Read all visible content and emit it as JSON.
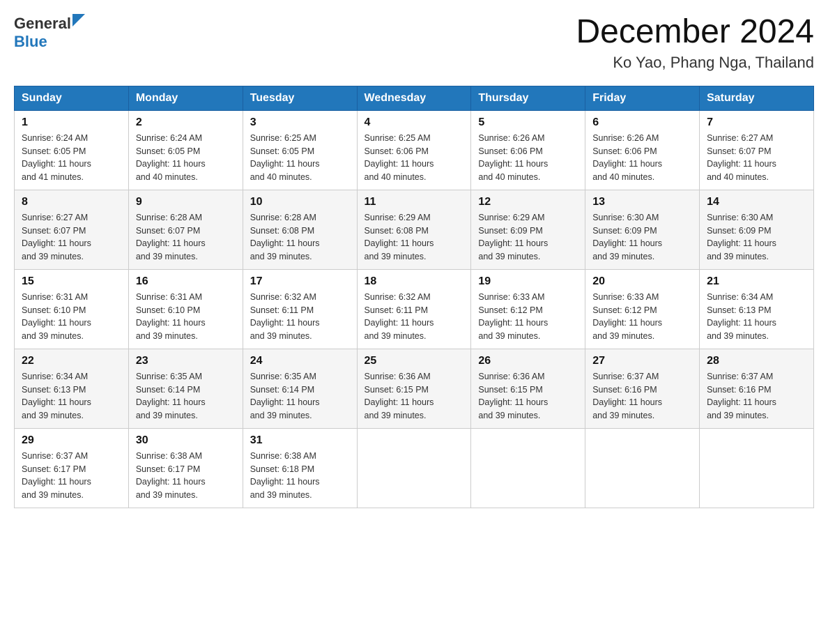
{
  "header": {
    "logo_general": "General",
    "logo_blue": "Blue",
    "month_title": "December 2024",
    "location": "Ko Yao, Phang Nga, Thailand"
  },
  "weekdays": [
    "Sunday",
    "Monday",
    "Tuesday",
    "Wednesday",
    "Thursday",
    "Friday",
    "Saturday"
  ],
  "weeks": [
    [
      {
        "day": "1",
        "sunrise": "6:24 AM",
        "sunset": "6:05 PM",
        "daylight": "11 hours and 41 minutes."
      },
      {
        "day": "2",
        "sunrise": "6:24 AM",
        "sunset": "6:05 PM",
        "daylight": "11 hours and 40 minutes."
      },
      {
        "day": "3",
        "sunrise": "6:25 AM",
        "sunset": "6:05 PM",
        "daylight": "11 hours and 40 minutes."
      },
      {
        "day": "4",
        "sunrise": "6:25 AM",
        "sunset": "6:06 PM",
        "daylight": "11 hours and 40 minutes."
      },
      {
        "day": "5",
        "sunrise": "6:26 AM",
        "sunset": "6:06 PM",
        "daylight": "11 hours and 40 minutes."
      },
      {
        "day": "6",
        "sunrise": "6:26 AM",
        "sunset": "6:06 PM",
        "daylight": "11 hours and 40 minutes."
      },
      {
        "day": "7",
        "sunrise": "6:27 AM",
        "sunset": "6:07 PM",
        "daylight": "11 hours and 40 minutes."
      }
    ],
    [
      {
        "day": "8",
        "sunrise": "6:27 AM",
        "sunset": "6:07 PM",
        "daylight": "11 hours and 39 minutes."
      },
      {
        "day": "9",
        "sunrise": "6:28 AM",
        "sunset": "6:07 PM",
        "daylight": "11 hours and 39 minutes."
      },
      {
        "day": "10",
        "sunrise": "6:28 AM",
        "sunset": "6:08 PM",
        "daylight": "11 hours and 39 minutes."
      },
      {
        "day": "11",
        "sunrise": "6:29 AM",
        "sunset": "6:08 PM",
        "daylight": "11 hours and 39 minutes."
      },
      {
        "day": "12",
        "sunrise": "6:29 AM",
        "sunset": "6:09 PM",
        "daylight": "11 hours and 39 minutes."
      },
      {
        "day": "13",
        "sunrise": "6:30 AM",
        "sunset": "6:09 PM",
        "daylight": "11 hours and 39 minutes."
      },
      {
        "day": "14",
        "sunrise": "6:30 AM",
        "sunset": "6:09 PM",
        "daylight": "11 hours and 39 minutes."
      }
    ],
    [
      {
        "day": "15",
        "sunrise": "6:31 AM",
        "sunset": "6:10 PM",
        "daylight": "11 hours and 39 minutes."
      },
      {
        "day": "16",
        "sunrise": "6:31 AM",
        "sunset": "6:10 PM",
        "daylight": "11 hours and 39 minutes."
      },
      {
        "day": "17",
        "sunrise": "6:32 AM",
        "sunset": "6:11 PM",
        "daylight": "11 hours and 39 minutes."
      },
      {
        "day": "18",
        "sunrise": "6:32 AM",
        "sunset": "6:11 PM",
        "daylight": "11 hours and 39 minutes."
      },
      {
        "day": "19",
        "sunrise": "6:33 AM",
        "sunset": "6:12 PM",
        "daylight": "11 hours and 39 minutes."
      },
      {
        "day": "20",
        "sunrise": "6:33 AM",
        "sunset": "6:12 PM",
        "daylight": "11 hours and 39 minutes."
      },
      {
        "day": "21",
        "sunrise": "6:34 AM",
        "sunset": "6:13 PM",
        "daylight": "11 hours and 39 minutes."
      }
    ],
    [
      {
        "day": "22",
        "sunrise": "6:34 AM",
        "sunset": "6:13 PM",
        "daylight": "11 hours and 39 minutes."
      },
      {
        "day": "23",
        "sunrise": "6:35 AM",
        "sunset": "6:14 PM",
        "daylight": "11 hours and 39 minutes."
      },
      {
        "day": "24",
        "sunrise": "6:35 AM",
        "sunset": "6:14 PM",
        "daylight": "11 hours and 39 minutes."
      },
      {
        "day": "25",
        "sunrise": "6:36 AM",
        "sunset": "6:15 PM",
        "daylight": "11 hours and 39 minutes."
      },
      {
        "day": "26",
        "sunrise": "6:36 AM",
        "sunset": "6:15 PM",
        "daylight": "11 hours and 39 minutes."
      },
      {
        "day": "27",
        "sunrise": "6:37 AM",
        "sunset": "6:16 PM",
        "daylight": "11 hours and 39 minutes."
      },
      {
        "day": "28",
        "sunrise": "6:37 AM",
        "sunset": "6:16 PM",
        "daylight": "11 hours and 39 minutes."
      }
    ],
    [
      {
        "day": "29",
        "sunrise": "6:37 AM",
        "sunset": "6:17 PM",
        "daylight": "11 hours and 39 minutes."
      },
      {
        "day": "30",
        "sunrise": "6:38 AM",
        "sunset": "6:17 PM",
        "daylight": "11 hours and 39 minutes."
      },
      {
        "day": "31",
        "sunrise": "6:38 AM",
        "sunset": "6:18 PM",
        "daylight": "11 hours and 39 minutes."
      },
      null,
      null,
      null,
      null
    ]
  ],
  "labels": {
    "sunrise": "Sunrise:",
    "sunset": "Sunset:",
    "daylight": "Daylight:"
  }
}
